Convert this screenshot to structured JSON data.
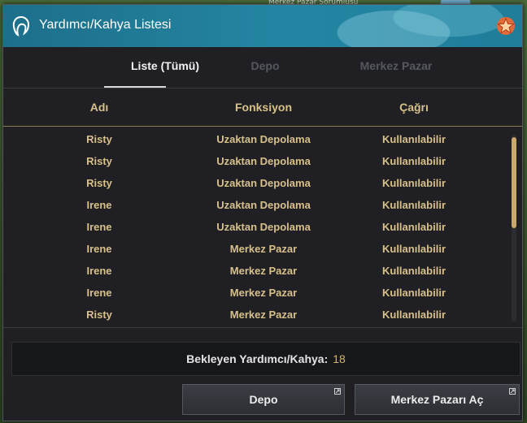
{
  "window": {
    "title": "Yardımcı/Kahya Listesi",
    "background_hint": "Merkez Pazar Sorumlusu"
  },
  "tabs": [
    {
      "label": "Liste (Tümü)",
      "active": true
    },
    {
      "label": "Depo",
      "active": false
    },
    {
      "label": "Merkez Pazar",
      "active": false
    }
  ],
  "columns": {
    "name": "Adı",
    "function": "Fonksiyon",
    "call": "Çağrı"
  },
  "rows": [
    {
      "name": "Risty",
      "function": "Uzaktan Depolama",
      "call": "Kullanılabilir"
    },
    {
      "name": "Risty",
      "function": "Uzaktan Depolama",
      "call": "Kullanılabilir"
    },
    {
      "name": "Risty",
      "function": "Uzaktan Depolama",
      "call": "Kullanılabilir"
    },
    {
      "name": "Irene",
      "function": "Uzaktan Depolama",
      "call": "Kullanılabilir"
    },
    {
      "name": "Irene",
      "function": "Uzaktan Depolama",
      "call": "Kullanılabilir"
    },
    {
      "name": "Irene",
      "function": "Merkez Pazar",
      "call": "Kullanılabilir"
    },
    {
      "name": "Irene",
      "function": "Merkez Pazar",
      "call": "Kullanılabilir"
    },
    {
      "name": "Irene",
      "function": "Merkez Pazar",
      "call": "Kullanılabilir"
    },
    {
      "name": "Risty",
      "function": "Merkez Pazar",
      "call": "Kullanılabilir"
    }
  ],
  "pending": {
    "label": "Bekleyen Yardımcı/Kahya:",
    "count": "18"
  },
  "buttons": {
    "depot": "Depo",
    "market": "Merkez Pazarı Aç"
  },
  "colors": {
    "accent_gold": "#d7c08a",
    "title_bar": "#2486a3",
    "panel_bg": "#202024"
  },
  "icons": {
    "title": "hair-silhouette-icon",
    "close": "star-close-icon",
    "expand": "expand-corner-icon"
  }
}
